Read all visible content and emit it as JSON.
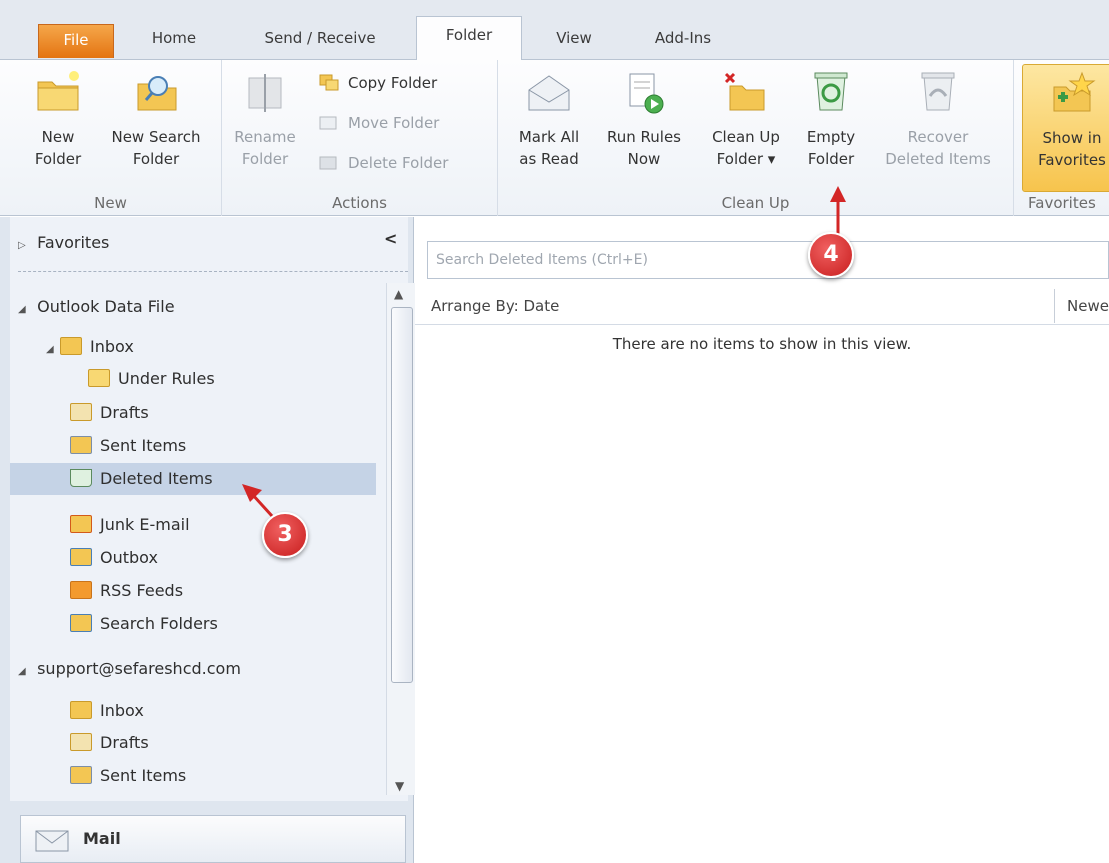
{
  "tabs": [
    "File",
    "Home",
    "Send / Receive",
    "Folder",
    "View",
    "Add-Ins"
  ],
  "ribbon": {
    "new_group": {
      "label": "New",
      "new_folder": [
        "New",
        "Folder"
      ],
      "new_search_folder": [
        "New Search",
        "Folder"
      ]
    },
    "actions_group": {
      "label": "Actions",
      "rename_folder": [
        "Rename",
        "Folder"
      ],
      "copy_folder": "Copy Folder",
      "move_folder": "Move Folder",
      "delete_folder": "Delete Folder"
    },
    "cleanup_group": {
      "label": "Clean Up",
      "mark_all_read": [
        "Mark All",
        "as Read"
      ],
      "run_rules_now": [
        "Run Rules",
        "Now"
      ],
      "clean_up_folder": [
        "Clean Up",
        "Folder ▾"
      ],
      "empty_folder": [
        "Empty",
        "Folder"
      ],
      "recover_deleted": [
        "Recover",
        "Deleted Items"
      ]
    },
    "favorites_group": {
      "label": "Favorites",
      "show_in_favorites": [
        "Show in",
        "Favorites"
      ]
    }
  },
  "nav": {
    "favorites": "Favorites",
    "collapse_glyph": "<",
    "outlook_data_file": "Outlook Data File",
    "items": {
      "inbox": "Inbox",
      "under_rules": "Under Rules",
      "drafts": "Drafts",
      "sent_items": "Sent Items",
      "deleted_items": "Deleted Items",
      "junk": "Junk E-mail",
      "outbox": "Outbox",
      "rss": "RSS Feeds",
      "search_folders": "Search Folders"
    },
    "account": "support@sefareshcd.com",
    "account_items": {
      "inbox": "Inbox",
      "drafts": "Drafts",
      "sent_items": "Sent Items"
    },
    "mail_button": "Mail"
  },
  "main": {
    "search_placeholder": "Search Deleted Items (Ctrl+E)",
    "arrange_by": "Arrange By: Date",
    "sort": "Newe",
    "empty_message": "There are no items to show in this view."
  },
  "callouts": {
    "three": "3",
    "four": "4"
  },
  "colors": {
    "file_tab": "#e47412",
    "callout": "#d32626",
    "selected": "#c5d3e6"
  }
}
